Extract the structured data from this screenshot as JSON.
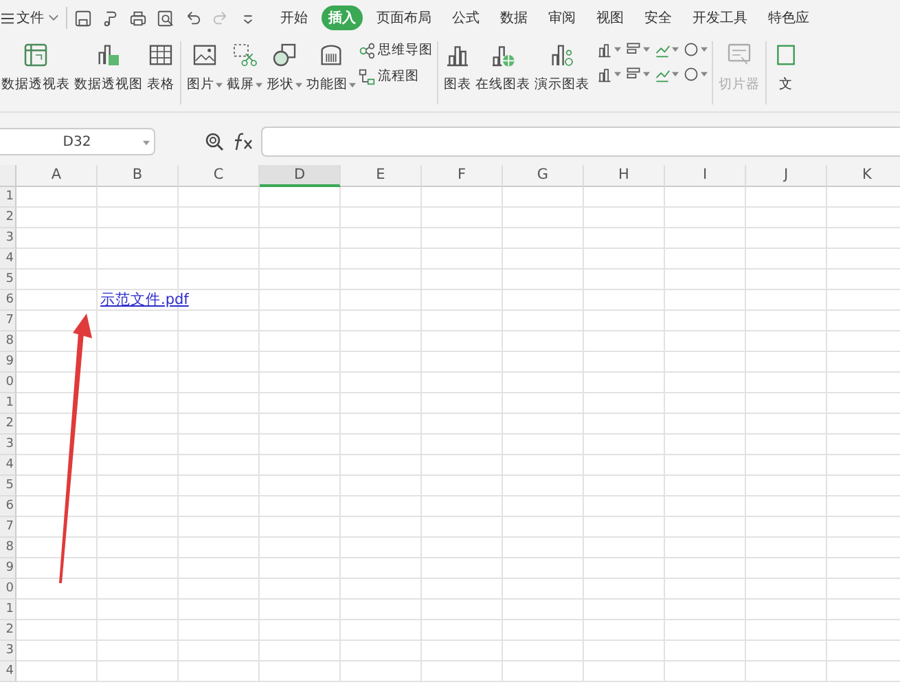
{
  "menu_bar": {
    "file_menu": "文件",
    "tabs": [
      {
        "label": "开始",
        "selected": false
      },
      {
        "label": "插入",
        "selected": true
      },
      {
        "label": "页面布局",
        "selected": false
      },
      {
        "label": "公式",
        "selected": false
      },
      {
        "label": "数据",
        "selected": false
      },
      {
        "label": "审阅",
        "selected": false
      },
      {
        "label": "视图",
        "selected": false
      },
      {
        "label": "安全",
        "selected": false
      },
      {
        "label": "开发工具",
        "selected": false
      },
      {
        "label": "特色应",
        "selected": false
      }
    ]
  },
  "ribbon": {
    "groups": [
      {
        "items": [
          {
            "kind": "large",
            "label": "数据透视表",
            "caret": false,
            "disabled": false
          },
          {
            "kind": "large",
            "label": "数据透视图",
            "caret": false,
            "disabled": false
          },
          {
            "kind": "large",
            "label": "表格",
            "caret": false,
            "disabled": false
          }
        ]
      },
      {
        "items": [
          {
            "kind": "large",
            "label": "图片",
            "caret": true,
            "disabled": false
          },
          {
            "kind": "large",
            "label": "截屏",
            "caret": true,
            "disabled": false
          },
          {
            "kind": "large",
            "label": "形状",
            "caret": true,
            "disabled": false
          },
          {
            "kind": "large",
            "label": "功能图",
            "caret": true,
            "disabled": false
          },
          {
            "kind": "stack",
            "entries": [
              {
                "label": "思维导图"
              },
              {
                "label": "流程图"
              }
            ]
          }
        ]
      },
      {
        "items": [
          {
            "kind": "large",
            "label": "图表",
            "caret": false,
            "disabled": false
          },
          {
            "kind": "large",
            "label": "在线图表",
            "caret": false,
            "disabled": false
          },
          {
            "kind": "large",
            "label": "演示图表",
            "caret": false,
            "disabled": false
          },
          {
            "kind": "grid"
          }
        ]
      },
      {
        "items": [
          {
            "kind": "large",
            "label": "切片器",
            "caret": false,
            "disabled": true
          }
        ]
      },
      {
        "items": [
          {
            "kind": "large",
            "label": "文",
            "caret": false,
            "disabled": false
          }
        ]
      }
    ]
  },
  "formula_bar": {
    "name_box": "D32"
  },
  "sheet": {
    "columns": [
      {
        "label": "A",
        "selected": false
      },
      {
        "label": "B",
        "selected": false
      },
      {
        "label": "C",
        "selected": false
      },
      {
        "label": "D",
        "selected": true
      },
      {
        "label": "E",
        "selected": false
      },
      {
        "label": "F",
        "selected": false
      },
      {
        "label": "G",
        "selected": false
      },
      {
        "label": "H",
        "selected": false
      },
      {
        "label": "I",
        "selected": false
      },
      {
        "label": "J",
        "selected": false
      },
      {
        "label": "K",
        "selected": false
      }
    ],
    "rows": [
      {
        "header": "1"
      },
      {
        "header": "2"
      },
      {
        "header": "3"
      },
      {
        "header": "4"
      },
      {
        "header": "5"
      },
      {
        "header": "6",
        "column_b": "示范文件.pdf"
      },
      {
        "header": "7"
      },
      {
        "header": "8"
      },
      {
        "header": "9"
      },
      {
        "header": "0"
      },
      {
        "header": "1"
      },
      {
        "header": "2"
      },
      {
        "header": "3"
      },
      {
        "header": "4"
      },
      {
        "header": "5"
      },
      {
        "header": "6"
      },
      {
        "header": "7"
      },
      {
        "header": "8"
      },
      {
        "header": "9"
      },
      {
        "header": "0"
      },
      {
        "header": "1"
      },
      {
        "header": "2"
      },
      {
        "header": "3"
      },
      {
        "header": "4"
      }
    ]
  }
}
